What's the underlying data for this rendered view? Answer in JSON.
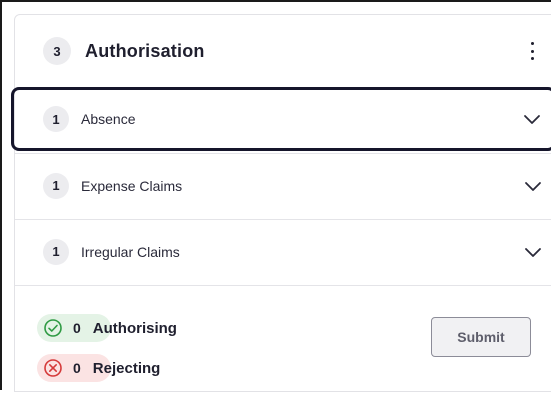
{
  "panel": {
    "count": "3",
    "title": "Authorisation",
    "menu_icon": "more-vertical-icon"
  },
  "items": [
    {
      "count": "1",
      "label": "Absence",
      "icon": "chevron-down-icon",
      "focused": true
    },
    {
      "count": "1",
      "label": "Expense Claims",
      "icon": "chevron-down-icon",
      "focused": false
    },
    {
      "count": "1",
      "label": "Irregular Claims",
      "icon": "chevron-down-icon",
      "focused": false
    }
  ],
  "summary": {
    "authorising": {
      "count": "0",
      "label": "Authorising",
      "icon": "check-circle-icon",
      "color": "#2e9a43"
    },
    "rejecting": {
      "count": "0",
      "label": "Rejecting",
      "icon": "x-circle-icon",
      "color": "#d53a3a"
    }
  },
  "actions": {
    "submit_label": "Submit"
  }
}
